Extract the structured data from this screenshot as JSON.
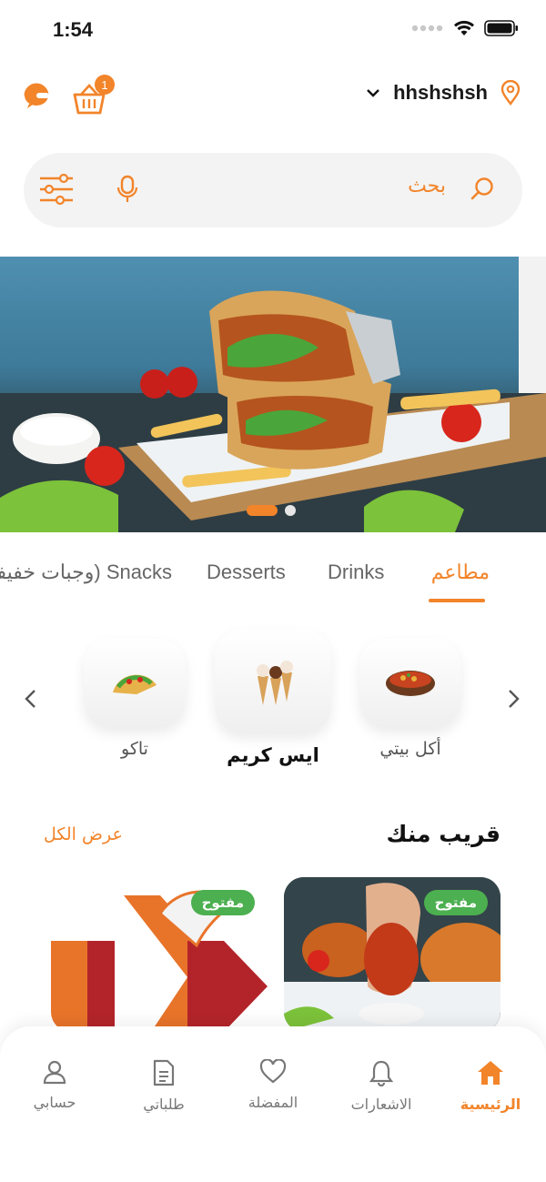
{
  "status_bar": {
    "time": "1:54"
  },
  "header": {
    "location_name": "hhshshsh",
    "cart_count": "1",
    "icons": [
      "support-icon",
      "cart-icon",
      "chevron-down-icon",
      "location-pin-icon"
    ]
  },
  "search": {
    "placeholder": "بحث"
  },
  "banner": {
    "slide_count": 2,
    "active_slide": 1
  },
  "tabs": [
    {
      "label": "مطاعم",
      "active": true
    },
    {
      "label": "Drinks",
      "active": false
    },
    {
      "label": "Desserts",
      "active": false
    },
    {
      "label": "Snacks (وجبات خفيفة)",
      "active": false
    }
  ],
  "categories": [
    {
      "label": "أكل بيتي",
      "icon": "home-food-icon"
    },
    {
      "label": "ايس كريم",
      "icon": "ice-cream-icon",
      "selected": true
    },
    {
      "label": "تاكو",
      "icon": "taco-icon"
    }
  ],
  "nearby": {
    "title": "قريب منك",
    "view_all": "عرض الكل",
    "cards": [
      {
        "status": "مفتوح"
      },
      {
        "status": "مفتوح"
      }
    ]
  },
  "bottom_nav": [
    {
      "label": "الرئيسية",
      "icon": "home-icon",
      "active": true
    },
    {
      "label": "الاشعارات",
      "icon": "bell-icon"
    },
    {
      "label": "المفضلة",
      "icon": "heart-icon"
    },
    {
      "label": "طلباتي",
      "icon": "orders-icon"
    },
    {
      "label": "حسابي",
      "icon": "user-icon"
    }
  ],
  "colors": {
    "accent": "#f2842a",
    "open_badge": "#4caf50"
  }
}
